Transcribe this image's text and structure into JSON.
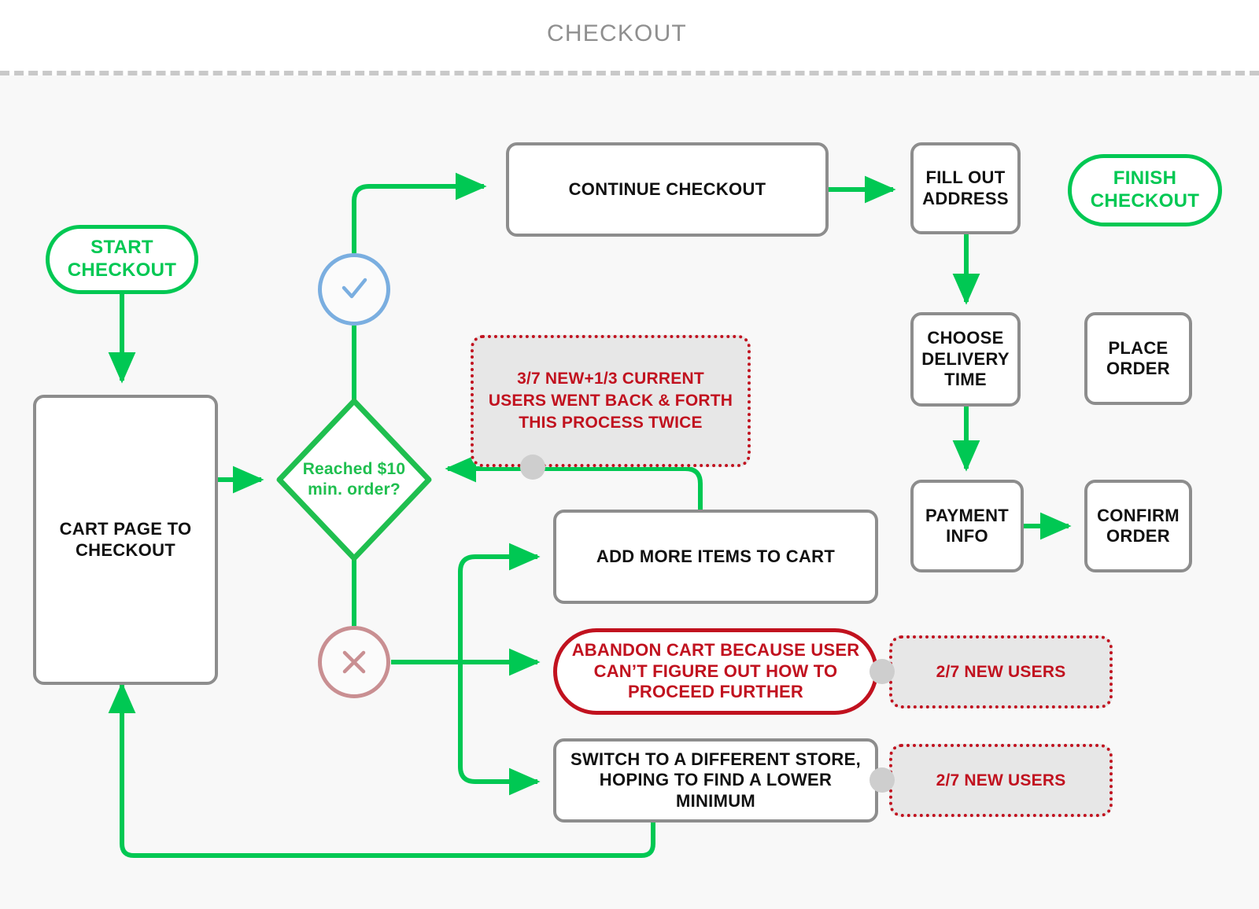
{
  "header": {
    "title": "CHECKOUT"
  },
  "colors": {
    "flow_green": "#00c853",
    "decision_green": "#1fbf4f",
    "box_gray": "#8d8d8d",
    "annotation_red": "#c1121f",
    "annotation_fill": "#e7e7e7",
    "gate_yes_blue": "#7aaee0",
    "gate_no_rose": "#c98f92",
    "canvas_bg": "#f8f8f8",
    "title_gray": "#8f8f8f",
    "anchor_dot_gray": "#cecece"
  },
  "nodes": {
    "start_checkout": {
      "label": "START\nCHECKOUT",
      "type": "terminator"
    },
    "cart_page": {
      "label": "CART PAGE TO\nCHECKOUT",
      "type": "process"
    },
    "decision": {
      "label": "Reached $10\nmin. order?",
      "type": "decision"
    },
    "continue_checkout": {
      "label": "CONTINUE CHECKOUT",
      "type": "process"
    },
    "fill_out_address": {
      "label": "FILL OUT\nADDRESS",
      "type": "process"
    },
    "choose_delivery_time": {
      "label": "CHOOSE\nDELIVERY\nTIME",
      "type": "process"
    },
    "payment_info": {
      "label": "PAYMENT\nINFO",
      "type": "process"
    },
    "confirm_order": {
      "label": "CONFIRM\nORDER",
      "type": "process"
    },
    "place_order": {
      "label": "PLACE\nORDER",
      "type": "process"
    },
    "finish_checkout": {
      "label": "FINISH\nCHECKOUT",
      "type": "terminator"
    },
    "add_more_items": {
      "label": "ADD MORE ITEMS TO CART",
      "type": "process"
    },
    "abandon_cart": {
      "label": "ABANDON CART BECAUSE USER\nCAN’T FIGURE OUT HOW TO\nPROCEED FURTHER",
      "type": "failure"
    },
    "switch_store": {
      "label": "SWITCH TO A DIFFERENT STORE,\nHOPING TO FIND A LOWER\nMINIMUM",
      "type": "process"
    }
  },
  "gates": {
    "yes": {
      "icon": "check-icon",
      "meaning": "yes"
    },
    "no": {
      "icon": "x-icon",
      "meaning": "no"
    }
  },
  "annotations": {
    "back_and_forth": {
      "text": "3/7 NEW+1/3 CURRENT\nUSERS WENT BACK & FORTH\nTHIS PROCESS TWICE"
    },
    "abandon_stat": {
      "text": "2/7 NEW USERS"
    },
    "switch_stat": {
      "text": "2/7 NEW USERS"
    }
  }
}
